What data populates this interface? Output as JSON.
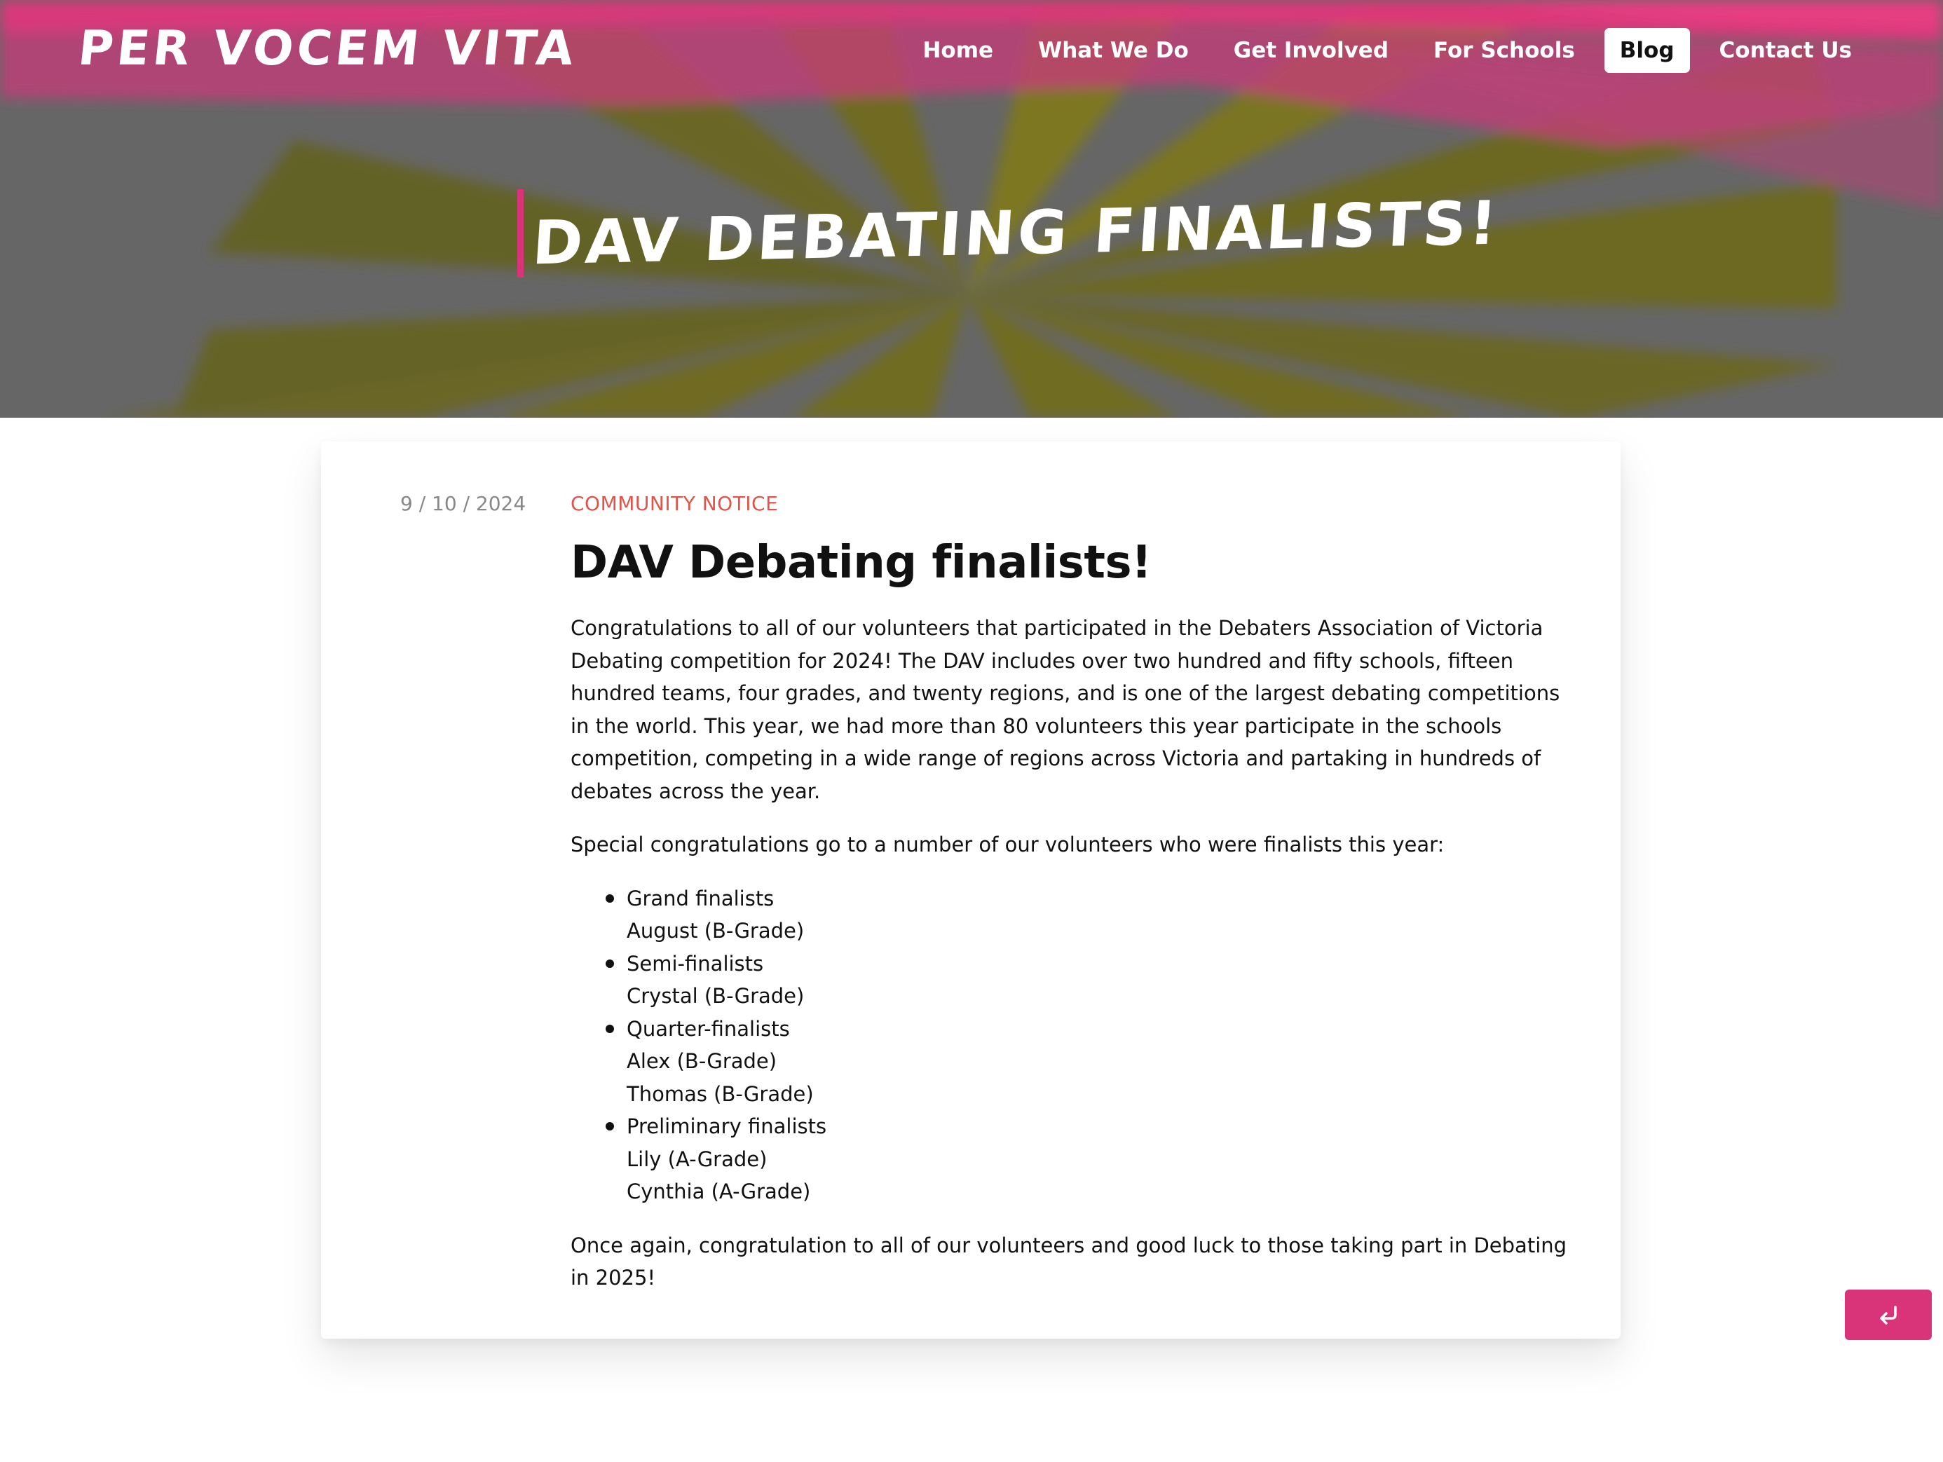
{
  "site": {
    "logo": "PER VOCEM VITA",
    "brand_color": "#d9337a"
  },
  "nav": {
    "items": [
      {
        "label": "Home",
        "active": false
      },
      {
        "label": "What We Do",
        "active": false
      },
      {
        "label": "Get Involved",
        "active": false
      },
      {
        "label": "For Schools",
        "active": false
      },
      {
        "label": "Blog",
        "active": true
      },
      {
        "label": "Contact Us",
        "active": false
      }
    ]
  },
  "hero": {
    "title": "DAV DEBATING FINALISTS!"
  },
  "post": {
    "date": "9 / 10 / 2024",
    "category": "COMMUNITY NOTICE",
    "category_color": "#e1544b",
    "title": "DAV Debating finalists!",
    "intro": "Congratulations to all of our volunteers that participated in the Debaters Association of Victoria Debating competition for 2024! The DAV includes over two hundred and fifty schools, fifteen hundred teams, four grades, and twenty regions, and is one of the largest debating competitions in the world. This year, we had more than 80 volunteers this year participate in the schools competition, competing in a wide range of regions across Victoria and partaking in hundreds of debates across the year.",
    "special": "Special congratulations go to a number of our volunteers who were finalists this year:",
    "finalists": [
      {
        "stage": "Grand finalists",
        "names": [
          "August (B-Grade)"
        ]
      },
      {
        "stage": "Semi-finalists",
        "names": [
          "Crystal (B-Grade)"
        ]
      },
      {
        "stage": "Quarter-finalists",
        "names": [
          "Alex (B-Grade)",
          "Thomas (B-Grade)"
        ]
      },
      {
        "stage": "Preliminary finalists",
        "names": [
          "Lily (A-Grade)",
          "Cynthia (A-Grade)"
        ]
      }
    ],
    "closing": "Once again, congratulation to all of our volunteers and good luck to those taking part in Debating in 2025!"
  },
  "back_button": {
    "icon": "return-arrow-icon"
  }
}
